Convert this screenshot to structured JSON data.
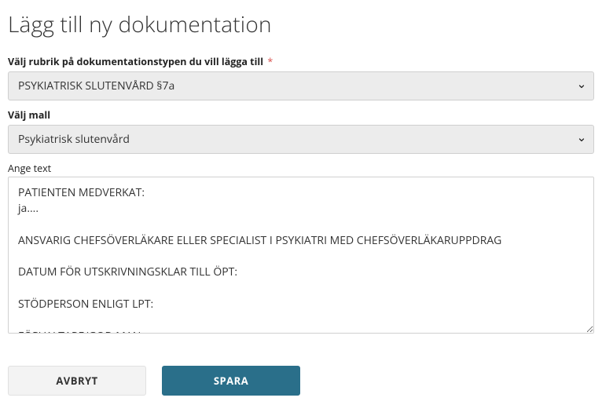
{
  "title": "Lägg till ny dokumentation",
  "fields": {
    "docTypeLabel": "Välj rubrik på dokumentationstypen du vill lägga till",
    "docTypeRequired": "*",
    "docTypeValue": "PSYKIATRISK SLUTENVÅRD §7a",
    "templateLabel": "Välj mall",
    "templateValue": "Psykiatrisk slutenvård",
    "textLabel": "Ange text",
    "textValue": "PATIENTEN MEDVERKAT:\nja....\n\nANSVARIG CHEFSÖVERLÄKARE ELLER SPECIALIST I PSYKIATRI MED CHEFSÖVERLÄKARUPPDRAG\n\nDATUM FÖR UTSKRIVNINGSKLAR TILL ÖPT:\n\nSTÖDPERSON ENLIGT LPT:\n\nFÖRVALTARE/GOD MAN:"
  },
  "buttons": {
    "cancel": "AVBRYT",
    "save": "SPARA"
  }
}
